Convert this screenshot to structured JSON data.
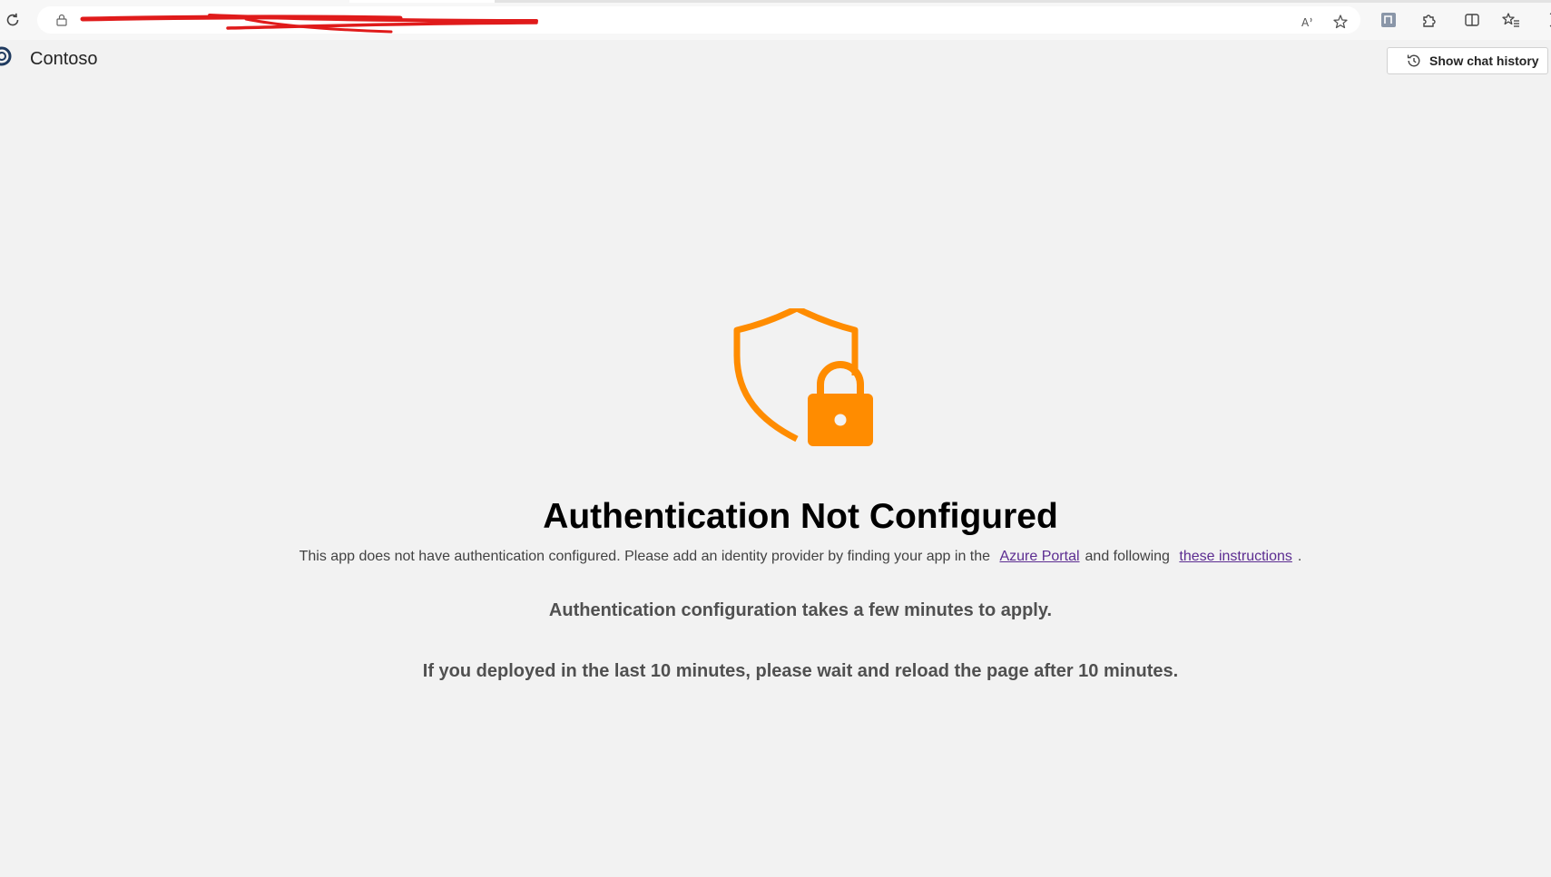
{
  "browser": {
    "toolbar_icons": [
      "read-aloud-icon",
      "favorite-star-icon",
      "extension-n-icon",
      "extensions-puzzle-icon",
      "split-screen-icon",
      "favorites-icon",
      "browser-essentials-icon"
    ]
  },
  "header": {
    "app_name": "Contoso",
    "show_history_label": "Show chat history"
  },
  "main": {
    "title": "Authentication Not Configured",
    "desc_part1": "This app does not have authentication configured. Please add an identity provider by finding your app in the",
    "link1": "Azure Portal",
    "desc_part2": "and following",
    "link2": "these instructions",
    "desc_end": ".",
    "note1": "Authentication configuration takes a few minutes to apply.",
    "note2": "If you deployed in the last 10 minutes, please wait and reload the page after 10 minutes."
  },
  "colors": {
    "accent": "#ff8c00",
    "link": "#5c2d91",
    "background": "#f2f2f2"
  }
}
